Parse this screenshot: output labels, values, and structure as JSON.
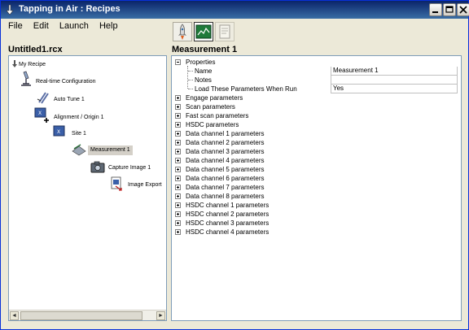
{
  "window": {
    "title": "Tapping in Air : Recipes",
    "minimize_label": "_",
    "maximize_label": "□",
    "close_label": "✕"
  },
  "menu": [
    "File",
    "Edit",
    "Launch",
    "Help"
  ],
  "toolbar": {
    "buttons": [
      "launch-rocket-icon",
      "measurement-graph-icon",
      "document-icon"
    ]
  },
  "left": {
    "title": "Untitled1.rcx",
    "tree": [
      {
        "label": "My Recipe",
        "icon": "recipe-icon"
      },
      {
        "label": "Real-time Configuration",
        "icon": "microscope-icon"
      },
      {
        "label": "Auto Tune 1",
        "icon": "tuning-fork-icon"
      },
      {
        "label": "Alignment / Origin 1",
        "icon": "alignment-icon"
      },
      {
        "label": "Site 1",
        "icon": "site-icon"
      },
      {
        "label": "Measurement 1",
        "icon": "measurement-icon",
        "selected": true
      },
      {
        "label": "Capture Image 1",
        "icon": "camera-icon"
      },
      {
        "label": "Image Export",
        "icon": "image-export-icon"
      }
    ],
    "scroll_left": "◄",
    "scroll_right": "►"
  },
  "right": {
    "title": "Measurement 1",
    "properties": {
      "label": "Properties",
      "expanded": true,
      "items": [
        {
          "name": "Name",
          "value": "Measurement 1"
        },
        {
          "name": "Notes",
          "value": ""
        },
        {
          "name": "Load These Parameters When Run",
          "value": "Yes"
        }
      ]
    },
    "groups": [
      "Engage parameters",
      "Scan parameters",
      "Fast scan parameters",
      "HSDC parameters",
      "Data channel 1 parameters",
      "Data channel 2 parameters",
      "Data channel 3 parameters",
      "Data channel 4 parameters",
      "Data channel 5 parameters",
      "Data channel 6 parameters",
      "Data channel 7 parameters",
      "Data channel 8 parameters",
      "HSDC channel 1 parameters",
      "HSDC channel 2 parameters",
      "HSDC channel 3 parameters",
      "HSDC channel 4 parameters"
    ]
  },
  "colors": {
    "titlebar": "#0a246a",
    "window_bg": "#ece9d8",
    "selection": "#d4d0c8"
  }
}
